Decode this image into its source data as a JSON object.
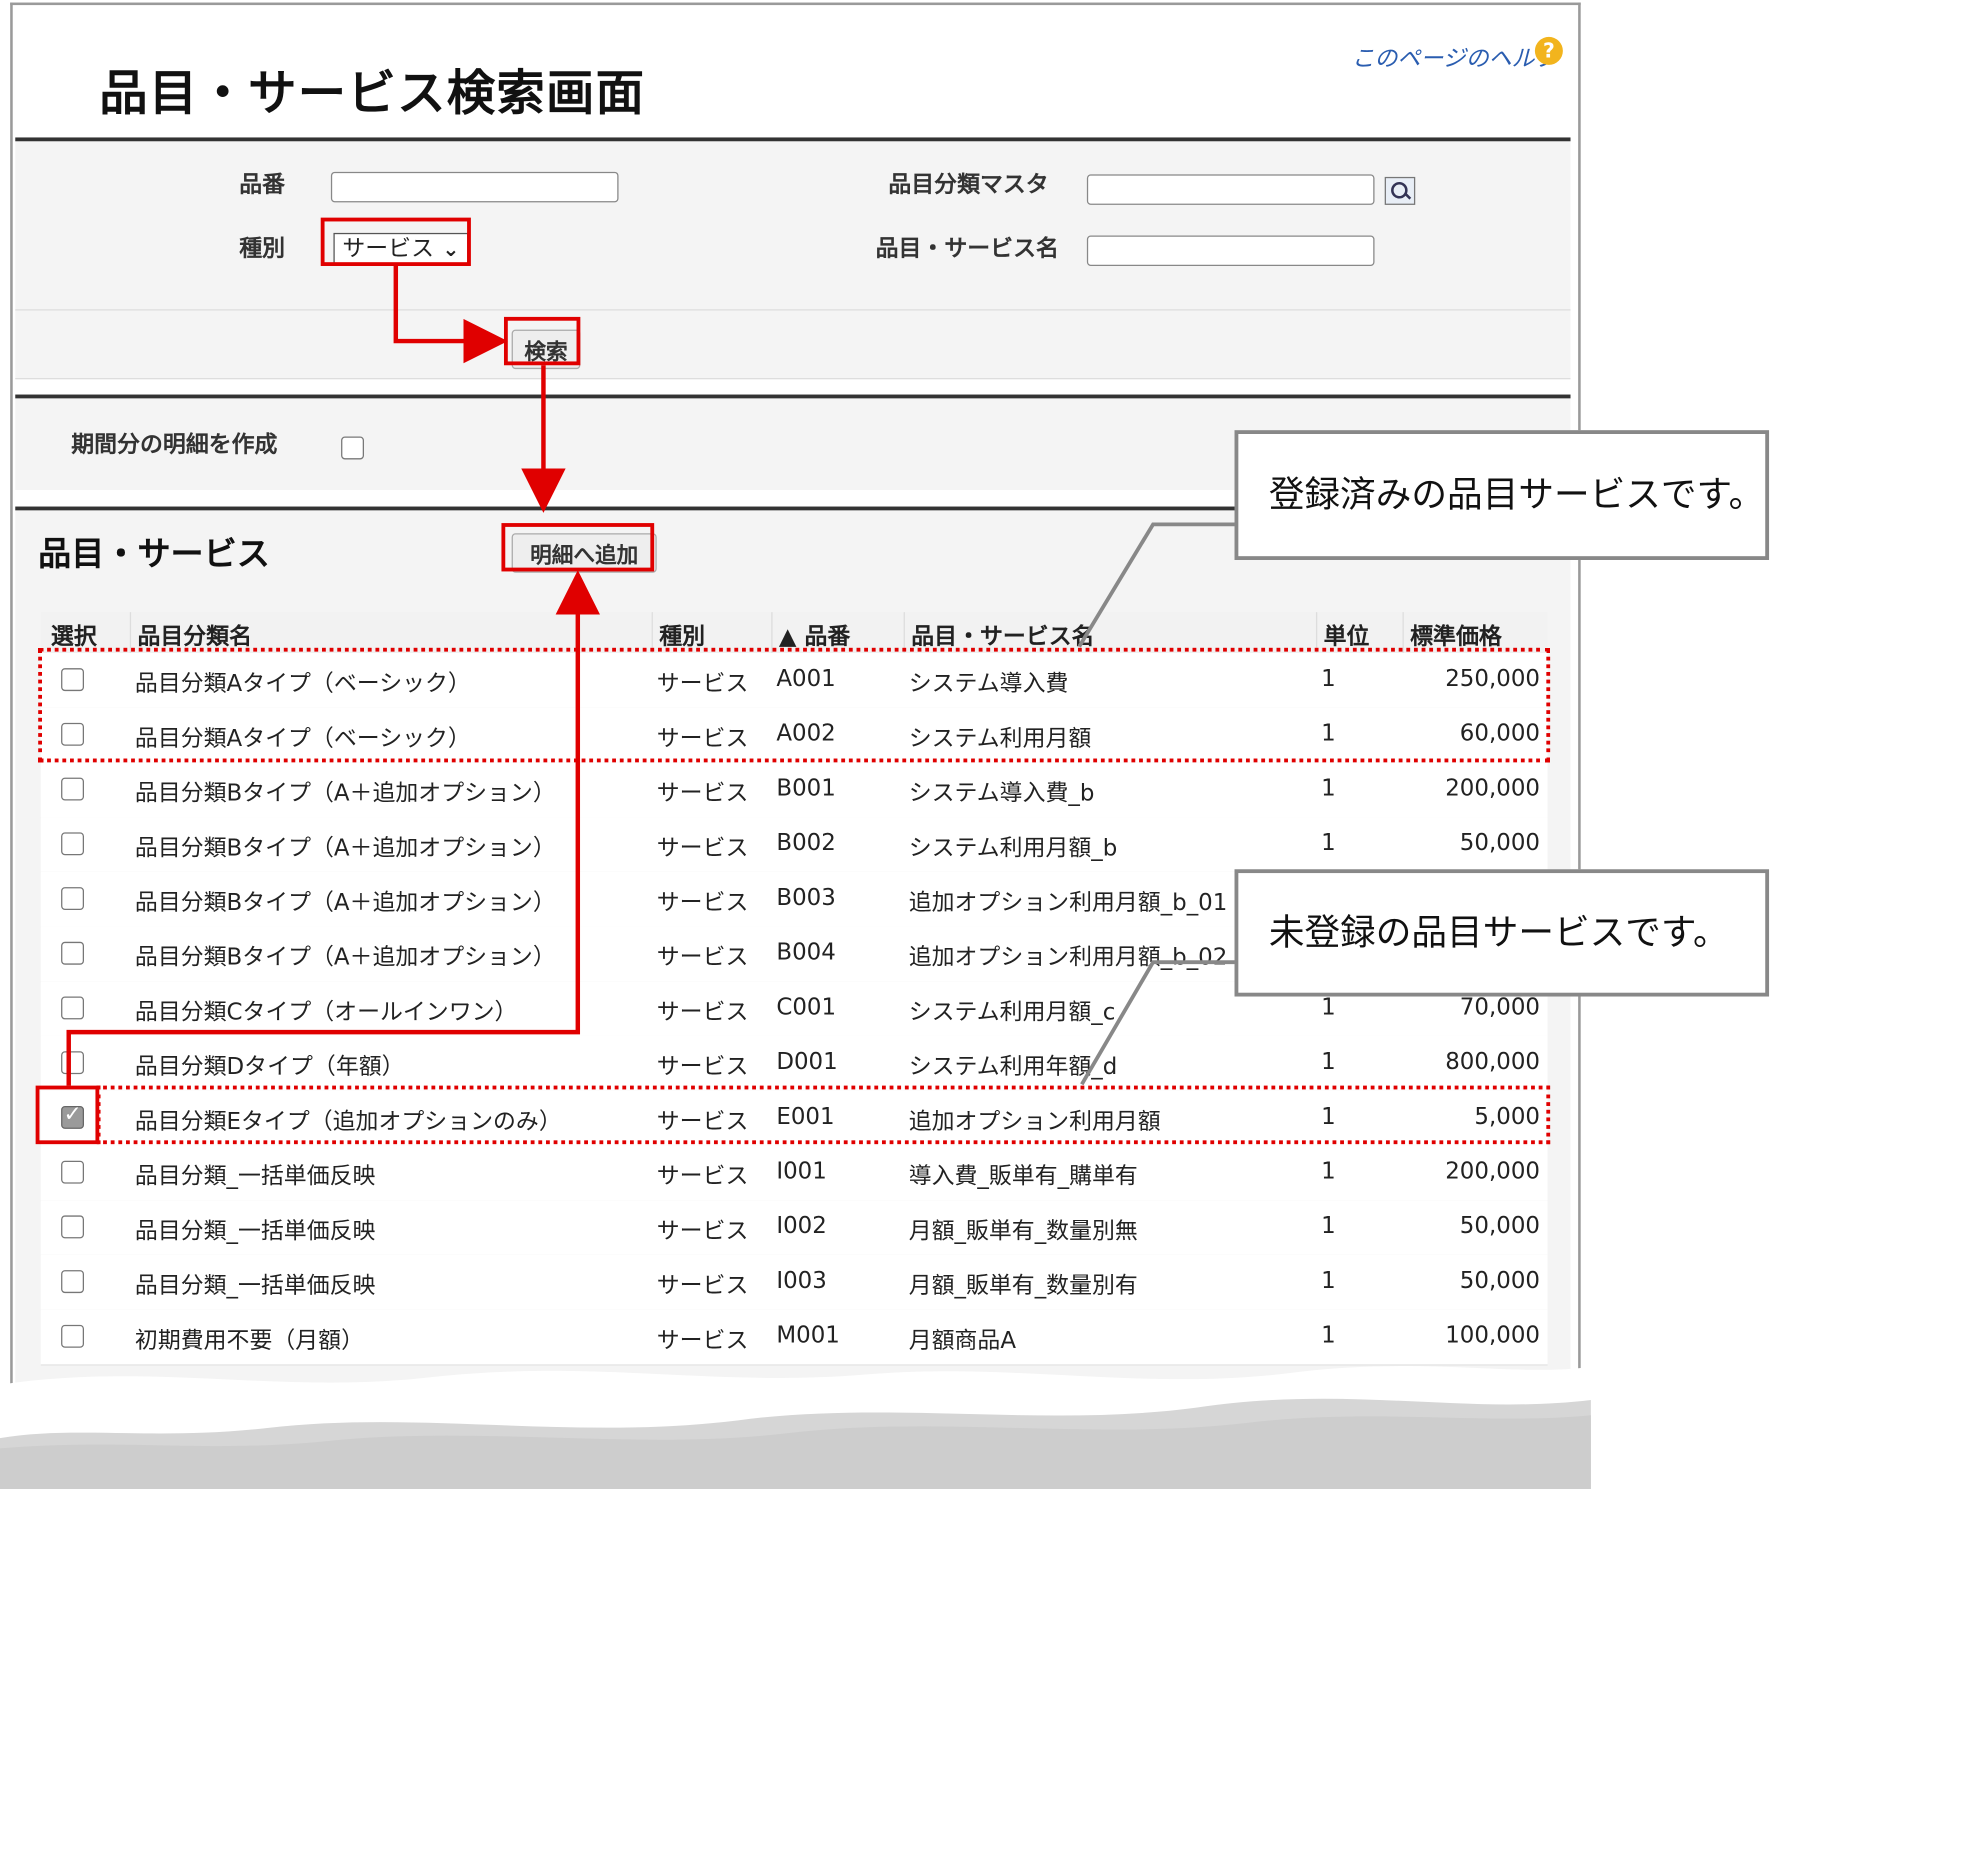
{
  "page": {
    "title": "品目・サービス検索画面",
    "help_link": "このページのヘルプ",
    "help_icon": "help-icon"
  },
  "search": {
    "part_no_label": "品番",
    "part_no_value": "",
    "type_label": "種別",
    "type_value": "サービス",
    "category_label": "品目分類マスタ",
    "category_value": "",
    "name_label": "品目・サービス名",
    "name_value": "",
    "search_button": "検索"
  },
  "period": {
    "label": "期間分の明細を作成",
    "checked": false
  },
  "results": {
    "title": "品目・サービス",
    "add_button": "明細へ追加",
    "columns": [
      "選択",
      "品目分類名",
      "種別",
      "▲ 品番",
      "品目・サービス名",
      "単位",
      "標準価格"
    ],
    "rows": [
      {
        "checked": false,
        "category": "品目分類Aタイプ（ベーシック）",
        "type": "サービス",
        "code": "A001",
        "name": "システム導入費",
        "unit": "1",
        "price": "250,000"
      },
      {
        "checked": false,
        "category": "品目分類Aタイプ（ベーシック）",
        "type": "サービス",
        "code": "A002",
        "name": "システム利用月額",
        "unit": "1",
        "price": "60,000"
      },
      {
        "checked": false,
        "category": "品目分類Bタイプ（A＋追加オプション）",
        "type": "サービス",
        "code": "B001",
        "name": "システム導入費_b",
        "unit": "1",
        "price": "200,000"
      },
      {
        "checked": false,
        "category": "品目分類Bタイプ（A＋追加オプション）",
        "type": "サービス",
        "code": "B002",
        "name": "システム利用月額_b",
        "unit": "1",
        "price": "50,000"
      },
      {
        "checked": false,
        "category": "品目分類Bタイプ（A＋追加オプション）",
        "type": "サービス",
        "code": "B003",
        "name": "追加オプション利用月額_b_01",
        "unit": "",
        "price": ""
      },
      {
        "checked": false,
        "category": "品目分類Bタイプ（A＋追加オプション）",
        "type": "サービス",
        "code": "B004",
        "name": "追加オプション利用月額_b_02",
        "unit": "",
        "price": ""
      },
      {
        "checked": false,
        "category": "品目分類Cタイプ（オールインワン）",
        "type": "サービス",
        "code": "C001",
        "name": "システム利用月額_c",
        "unit": "1",
        "price": "70,000"
      },
      {
        "checked": false,
        "category": "品目分類Dタイプ（年額）",
        "type": "サービス",
        "code": "D001",
        "name": "システム利用年額_d",
        "unit": "1",
        "price": "800,000"
      },
      {
        "checked": true,
        "category": "品目分類Eタイプ（追加オプションのみ）",
        "type": "サービス",
        "code": "E001",
        "name": "追加オプション利用月額",
        "unit": "1",
        "price": "5,000"
      },
      {
        "checked": false,
        "category": "品目分類_一括単価反映",
        "type": "サービス",
        "code": "I001",
        "name": "導入費_販単有_購単有",
        "unit": "1",
        "price": "200,000"
      },
      {
        "checked": false,
        "category": "品目分類_一括単価反映",
        "type": "サービス",
        "code": "I002",
        "name": "月額_販単有_数量別無",
        "unit": "1",
        "price": "50,000"
      },
      {
        "checked": false,
        "category": "品目分類_一括単価反映",
        "type": "サービス",
        "code": "I003",
        "name": "月額_販単有_数量別有",
        "unit": "1",
        "price": "50,000"
      },
      {
        "checked": false,
        "category": "初期費用不要（月額）",
        "type": "サービス",
        "code": "M001",
        "name": "月額商品A",
        "unit": "1",
        "price": "100,000"
      }
    ]
  },
  "callouts": {
    "registered": "登録済みの品目サービスです。",
    "unregistered": "未登録の品目サービスです。"
  },
  "colors": {
    "annotation_red": "#e00000",
    "callout_border": "#888888",
    "help_icon": "#f2b41d"
  }
}
